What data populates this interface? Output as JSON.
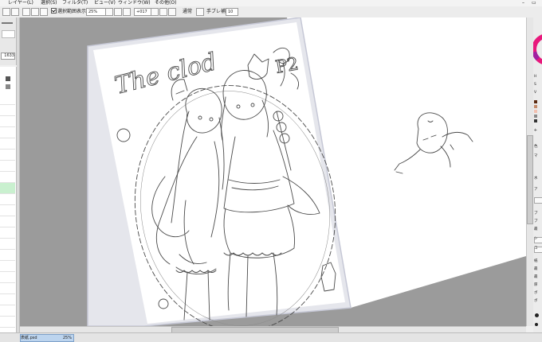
{
  "menu": {
    "items": [
      {
        "label": "レイヤー(L)"
      },
      {
        "label": "選択(S)"
      },
      {
        "label": "フィルタ(T)"
      },
      {
        "label": "ビュー(V)"
      },
      {
        "label": "ウィンドウ(W)"
      },
      {
        "label": "その他(O)"
      }
    ],
    "window_minimize": "–",
    "window_restore": "▭"
  },
  "toolbar": {
    "show_selection_label": "選択範囲表示",
    "zoom_value": "25%",
    "rotation_value": "+017",
    "normal_label": "通常",
    "stabilizer_label": "手ブレ補正",
    "stabilizer_value": "10"
  },
  "left_panel": {
    "brush_size_value": "1633"
  },
  "artwork": {
    "title_text": "The clod",
    "page_number": "P2"
  },
  "right_panel": {
    "labels": [
      "H",
      "S",
      "V",
      "色",
      "マ",
      "水",
      "ア",
      "ブ",
      "ブ",
      "最",
      "シ",
      "コ",
      "紙",
      "最",
      "最",
      "厚",
      "ボ",
      "ボ"
    ]
  },
  "status": {
    "document_name": "表紙.psd",
    "zoom": "25%"
  },
  "colors": {
    "canvas_background": "#9b9b9b",
    "paper": "#ffffff",
    "line_art": "#4a4a4a",
    "selected_tab": "#bcd4ee",
    "color_wheel_accent": "#e8187c"
  }
}
